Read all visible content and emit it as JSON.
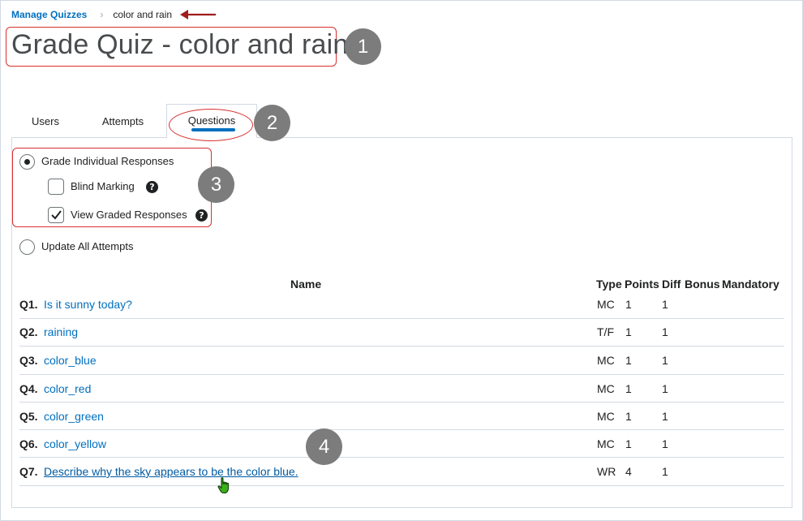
{
  "breadcrumb": {
    "parent": "Manage Quizzes",
    "separator": "›",
    "current": "color and rain"
  },
  "page": {
    "title": "Grade Quiz - color and rain"
  },
  "callouts": [
    "1",
    "2",
    "3",
    "4"
  ],
  "tabs": [
    {
      "label": "Users",
      "active": false
    },
    {
      "label": "Attempts",
      "active": false
    },
    {
      "label": "Questions",
      "active": true
    }
  ],
  "options": {
    "grade_individual": {
      "label": "Grade Individual Responses",
      "selected": true
    },
    "blind_marking": {
      "label": "Blind Marking",
      "checked": false
    },
    "view_graded": {
      "label": "View Graded Responses",
      "checked": true
    },
    "update_all": {
      "label": "Update All Attempts",
      "selected": false
    }
  },
  "table": {
    "headers": {
      "name": "Name",
      "type": "Type",
      "points": "Points",
      "diff": "Diff",
      "bonus": "Bonus",
      "mandatory": "Mandatory"
    },
    "rows": [
      {
        "num": "Q1.",
        "name": "Is it sunny today?",
        "type": "MC",
        "points": "1",
        "diff": "1"
      },
      {
        "num": "Q2.",
        "name": "raining",
        "type": "T/F",
        "points": "1",
        "diff": "1"
      },
      {
        "num": "Q3.",
        "name": "color_blue",
        "type": "MC",
        "points": "1",
        "diff": "1"
      },
      {
        "num": "Q4.",
        "name": "color_red",
        "type": "MC",
        "points": "1",
        "diff": "1"
      },
      {
        "num": "Q5.",
        "name": "color_green",
        "type": "MC",
        "points": "1",
        "diff": "1"
      },
      {
        "num": "Q6.",
        "name": "color_yellow",
        "type": "MC",
        "points": "1",
        "diff": "1"
      },
      {
        "num": "Q7.",
        "name": "Describe why the sky appears to be the color blue.",
        "type": "WR",
        "points": "4",
        "diff": "1"
      }
    ]
  },
  "colors": {
    "link": "#006fbf",
    "annotation_red": "#d8302f",
    "callout_gray": "#7c7c7c",
    "cursor_green": "#3cb01c"
  },
  "icons": {
    "arrow": "left-arrow-icon",
    "help": "help-circle-icon",
    "check": "checkmark-icon",
    "cursor": "hand-pointer-icon"
  }
}
